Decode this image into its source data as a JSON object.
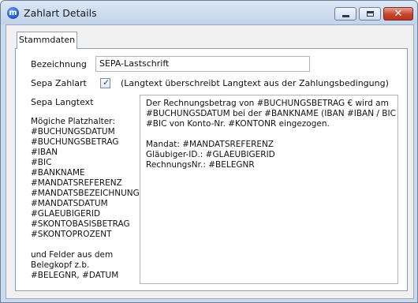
{
  "window": {
    "title": "Zahlart Details",
    "app_icon_letter": "m",
    "close_glyph": "✕"
  },
  "tabs": [
    "Stammdaten"
  ],
  "form": {
    "bezeichnung_label": "Bezeichnung",
    "bezeichnung_value": "SEPA-Lastschrift",
    "sepa_zahlart_label": "Sepa Zahlart",
    "sepa_zahlart_checked": true,
    "sepa_zahlart_hint": "(Langtext überschreibt Langtext aus der Zahlungsbedingung)",
    "sepa_langtext_label": "Sepa Langtext",
    "placeholders_title": "Mögiche Platzhalter:",
    "placeholders": [
      "#BUCHUNGSDATUM",
      "#BUCHUNGSBETRAG",
      "#IBAN",
      "#BIC",
      "#BANKNAME",
      "#MANDATSREFERENZ",
      "#MANDATSBEZEICHNUNG",
      "#MANDATSDATUM",
      "#GLAEUBIGERID",
      "#SKONTOBASISBETRAG",
      "#SKONTOPROZENT"
    ],
    "extra_note": [
      "und Felder aus dem",
      "Belegkopf z.b.",
      "#BELEGNR, #DATUM"
    ],
    "langtext_lines": [
      "Der Rechnungsbetrag von #BUCHUNGSBETRAG € wird am",
      "#BUCHUNGSDATUM bei der #BANKNAME (IBAN #IBAN / BIC",
      "#BIC von Konto-Nr. #KONTONR eingezogen.",
      "",
      "Mandat: #MANDATSREFERENZ",
      "Gläubiger-ID.: #GLAEUBIGERID",
      "RechnungsNr.: #BELEGNR"
    ]
  }
}
